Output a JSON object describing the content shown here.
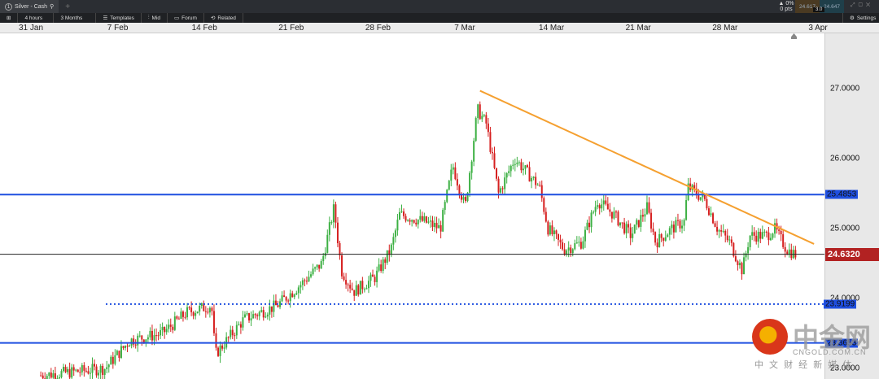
{
  "tab": {
    "title": "Silver - Cash",
    "number": "1",
    "add": "+"
  },
  "toolbar": {
    "interval": "4 hours",
    "range": "3 Months",
    "templates": "Templates",
    "mid": "Mid",
    "forum": "Forum",
    "related": "Related",
    "settings": "Settings"
  },
  "quote": {
    "change_pct": "▲ 0%",
    "change_pts": "0 pts",
    "bid": "24.617",
    "ask": "24.647",
    "spread": "3.0"
  },
  "watermark": {
    "brand": "中金网",
    "url": "CNGOLD.COM.CN",
    "tagline": "中 文 财 经 新 媒 体"
  },
  "colors": {
    "up": "#3cb043",
    "down": "#d62020",
    "level": "#1f4fe0",
    "trend": "#f5a030",
    "current": "#b22222"
  },
  "chart_data": {
    "type": "candlestick",
    "instrument": "Silver - Cash",
    "interval": "4 hours",
    "x_ticks": [
      "31 Jan",
      "7 Feb",
      "14 Feb",
      "21 Feb",
      "28 Feb",
      "7 Mar",
      "14 Mar",
      "21 Mar",
      "28 Mar",
      "3 Apr"
    ],
    "y_ticks": [
      "27.0000",
      "26.0000",
      "25.0000",
      "24.0000",
      "23.0000"
    ],
    "ylim": [
      22.85,
      27.9
    ],
    "price_path_day_price": [
      [
        0.8,
        22.9
      ],
      [
        6,
        23.0
      ],
      [
        8,
        23.4
      ],
      [
        10.6,
        23.5
      ],
      [
        12.6,
        23.8
      ],
      [
        14.6,
        23.9
      ],
      [
        14.9,
        23.2
      ],
      [
        17.2,
        23.7
      ],
      [
        19.9,
        23.9
      ],
      [
        21.8,
        24.2
      ],
      [
        23.5,
        24.5
      ],
      [
        24.5,
        25.3
      ],
      [
        25.1,
        24.4
      ],
      [
        26.1,
        24.1
      ],
      [
        27.8,
        24.3
      ],
      [
        29.1,
        24.7
      ],
      [
        29.8,
        25.2
      ],
      [
        31.8,
        25.1
      ],
      [
        33.1,
        25.0
      ],
      [
        34.1,
        25.9
      ],
      [
        35.1,
        25.3
      ],
      [
        36.1,
        26.7
      ],
      [
        36.8,
        26.5
      ],
      [
        37.8,
        25.5
      ],
      [
        39.1,
        26.0
      ],
      [
        41.1,
        25.6
      ],
      [
        41.8,
        25.0
      ],
      [
        43.1,
        24.7
      ],
      [
        44.5,
        24.8
      ],
      [
        45.8,
        25.4
      ],
      [
        47.1,
        25.2
      ],
      [
        48.5,
        24.9
      ],
      [
        49.8,
        25.3
      ],
      [
        50.5,
        24.8
      ],
      [
        51.8,
        25.0
      ],
      [
        52.8,
        25.1
      ],
      [
        53.1,
        25.6
      ],
      [
        54.5,
        25.4
      ],
      [
        55.5,
        25.0
      ],
      [
        56.5,
        24.8
      ],
      [
        57.5,
        24.4
      ],
      [
        58.1,
        24.9
      ],
      [
        59.5,
        24.9
      ],
      [
        60.1,
        25.0
      ],
      [
        61.1,
        24.7
      ],
      [
        61.8,
        24.63
      ]
    ],
    "horizontal_levels": [
      {
        "label": "25.4853",
        "value": 25.4853,
        "style": "solid"
      },
      {
        "label": "23.9199",
        "value": 23.9199,
        "style": "dotted"
      },
      {
        "label": "23.3653",
        "value": 23.3653,
        "style": "solid"
      }
    ],
    "current_price": {
      "label": "24.6320",
      "value": 24.632
    },
    "trendline": [
      [
        36.3,
        26.97
      ],
      [
        63.3,
        24.78
      ]
    ]
  }
}
